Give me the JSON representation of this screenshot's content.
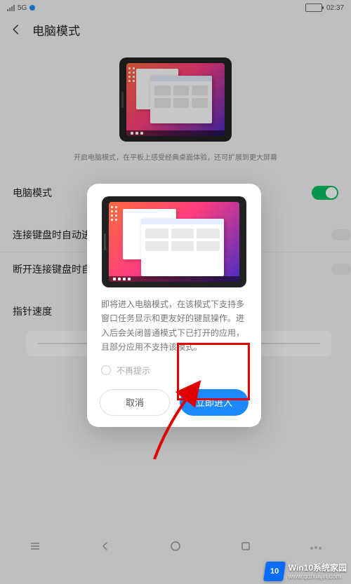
{
  "statusbar": {
    "signal_label": "5G",
    "time": "02:37"
  },
  "header": {
    "title": "电脑模式"
  },
  "hero": {
    "description": "开启电脑模式，在平板上感受经典桌面体验，还可扩展到更大屏幕"
  },
  "settings": {
    "pc_mode": {
      "label": "电脑模式",
      "value": true
    },
    "auto_enter_on_keyboard": {
      "label": "连接键盘时自动进入电脑模式",
      "value": false
    },
    "auto_exit_on_disconnect": {
      "label": "断开连接键盘时自动退出电脑模式",
      "value": false
    },
    "pointer_speed": {
      "label": "指针速度"
    }
  },
  "modal": {
    "description": "即将进入电脑模式，在该模式下支持多窗口任务显示和更友好的键鼠操作。进入后会关闭普通模式下已打开的应用，且部分应用不支持该模式。",
    "dont_show_again": "不再提示",
    "cancel": "取消",
    "confirm": "立即进入"
  },
  "watermark": {
    "logo_text": "10",
    "brand": "Win10系统家园",
    "url": "www.qdhuajin.com"
  }
}
